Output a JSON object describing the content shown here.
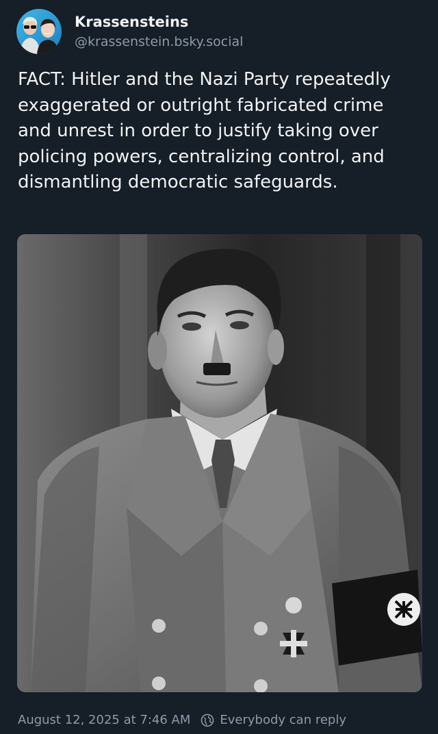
{
  "author": {
    "display_name": "Krassensteins",
    "handle": "@krassenstein.bsky.social",
    "avatar_icon": "avatar-two-men"
  },
  "post": {
    "text": "FACT: Hitler and the Nazi Party repeatedly exaggerated or outright fabricated crime and unrest in order to justify taking over policing powers, centralizing control, and dismantling democratic safeguards.",
    "image_icon": "black-and-white-portrait-photo"
  },
  "footer": {
    "timestamp": "August 12, 2025 at 7:46 AM",
    "reply_setting": "Everybody can reply",
    "reply_icon": "globe-icon"
  },
  "colors": {
    "background": "#161e27",
    "text": "#f1f3f5",
    "muted": "#8d9bab"
  }
}
